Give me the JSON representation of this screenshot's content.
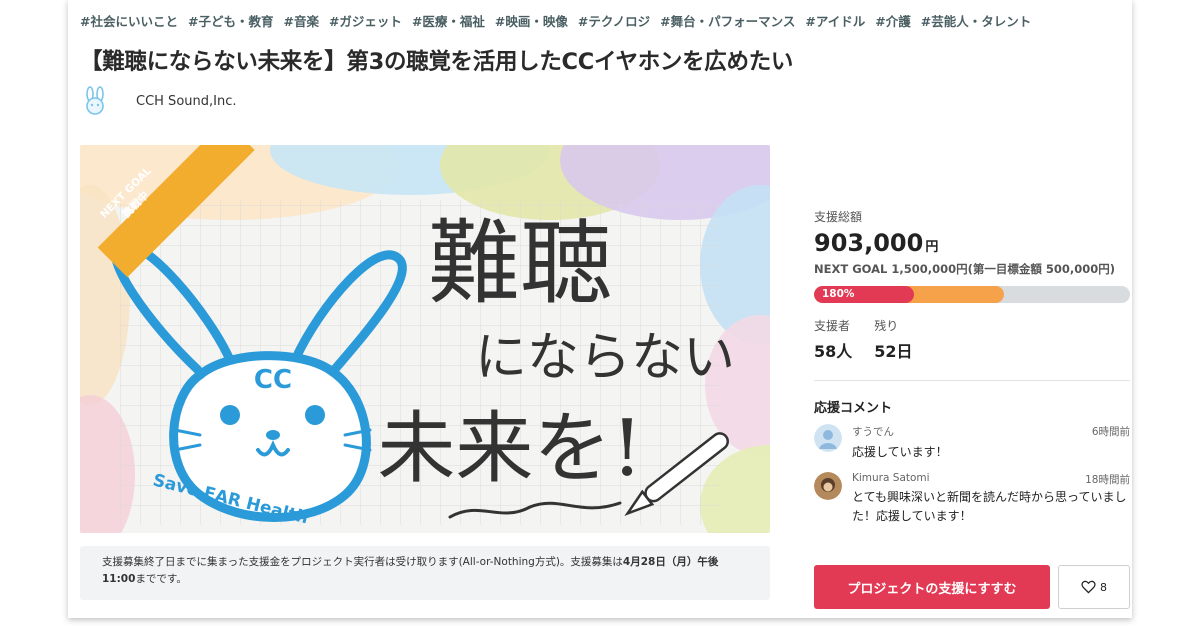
{
  "tags": [
    "#社会にいいこと",
    "#子ども・教育",
    "#音楽",
    "#ガジェット",
    "#医療・福祉",
    "#映画・映像",
    "#テクノロジ",
    "#舞台・パフォーマンス",
    "#アイドル",
    "#介護",
    "#芸能人・タレント"
  ],
  "project": {
    "title": "【難聴にならない未来を】第3の聴覚を活用したCCイヤホンを広めたい",
    "owner": "CCH Sound,Inc."
  },
  "hero": {
    "ribbon_line1": "NEXT GOAL",
    "ribbon_line2": "挑戦中",
    "cc_text": "CC",
    "arc_text": "Save EAR Health",
    "headline1": "難聴",
    "headline2": "にならない",
    "headline3": "未来を!"
  },
  "notice": {
    "part1": "支援募集終了日までに集まった支援金をプロジェクト実行者は受け取ります(All-or-Nothing方式)。支援募集は",
    "bold": "4月28日（月）午後11:00",
    "part2": "までです。"
  },
  "funding": {
    "total_label": "支援総額",
    "total_amount": "903,000",
    "currency": "円",
    "next_goal_text": "NEXT GOAL 1,500,000円(第一目標金額 500,000円)",
    "progress_label": "180%",
    "progress_to_next_goal": 0.602,
    "backers_label": "支援者",
    "backers_value": "58人",
    "remaining_label": "残り",
    "remaining_value": "52日"
  },
  "comments": {
    "title": "応援コメント",
    "items": [
      {
        "name": "すうでん",
        "time": "6時間前",
        "text": "応援しています！"
      },
      {
        "name": "Kimura Satomi",
        "time": "18時間前",
        "text": "とても興味深いと新聞を読んだ時から思っていました！応援しています！"
      }
    ]
  },
  "actions": {
    "support_button": "プロジェクトの支援にすすむ",
    "favorite_count": "8"
  },
  "colors": {
    "accent": "#e23a55",
    "progress_secondary": "#f5a24b",
    "rabbit_blue": "#2b9ad9",
    "tag_color": "#4a5f63"
  }
}
